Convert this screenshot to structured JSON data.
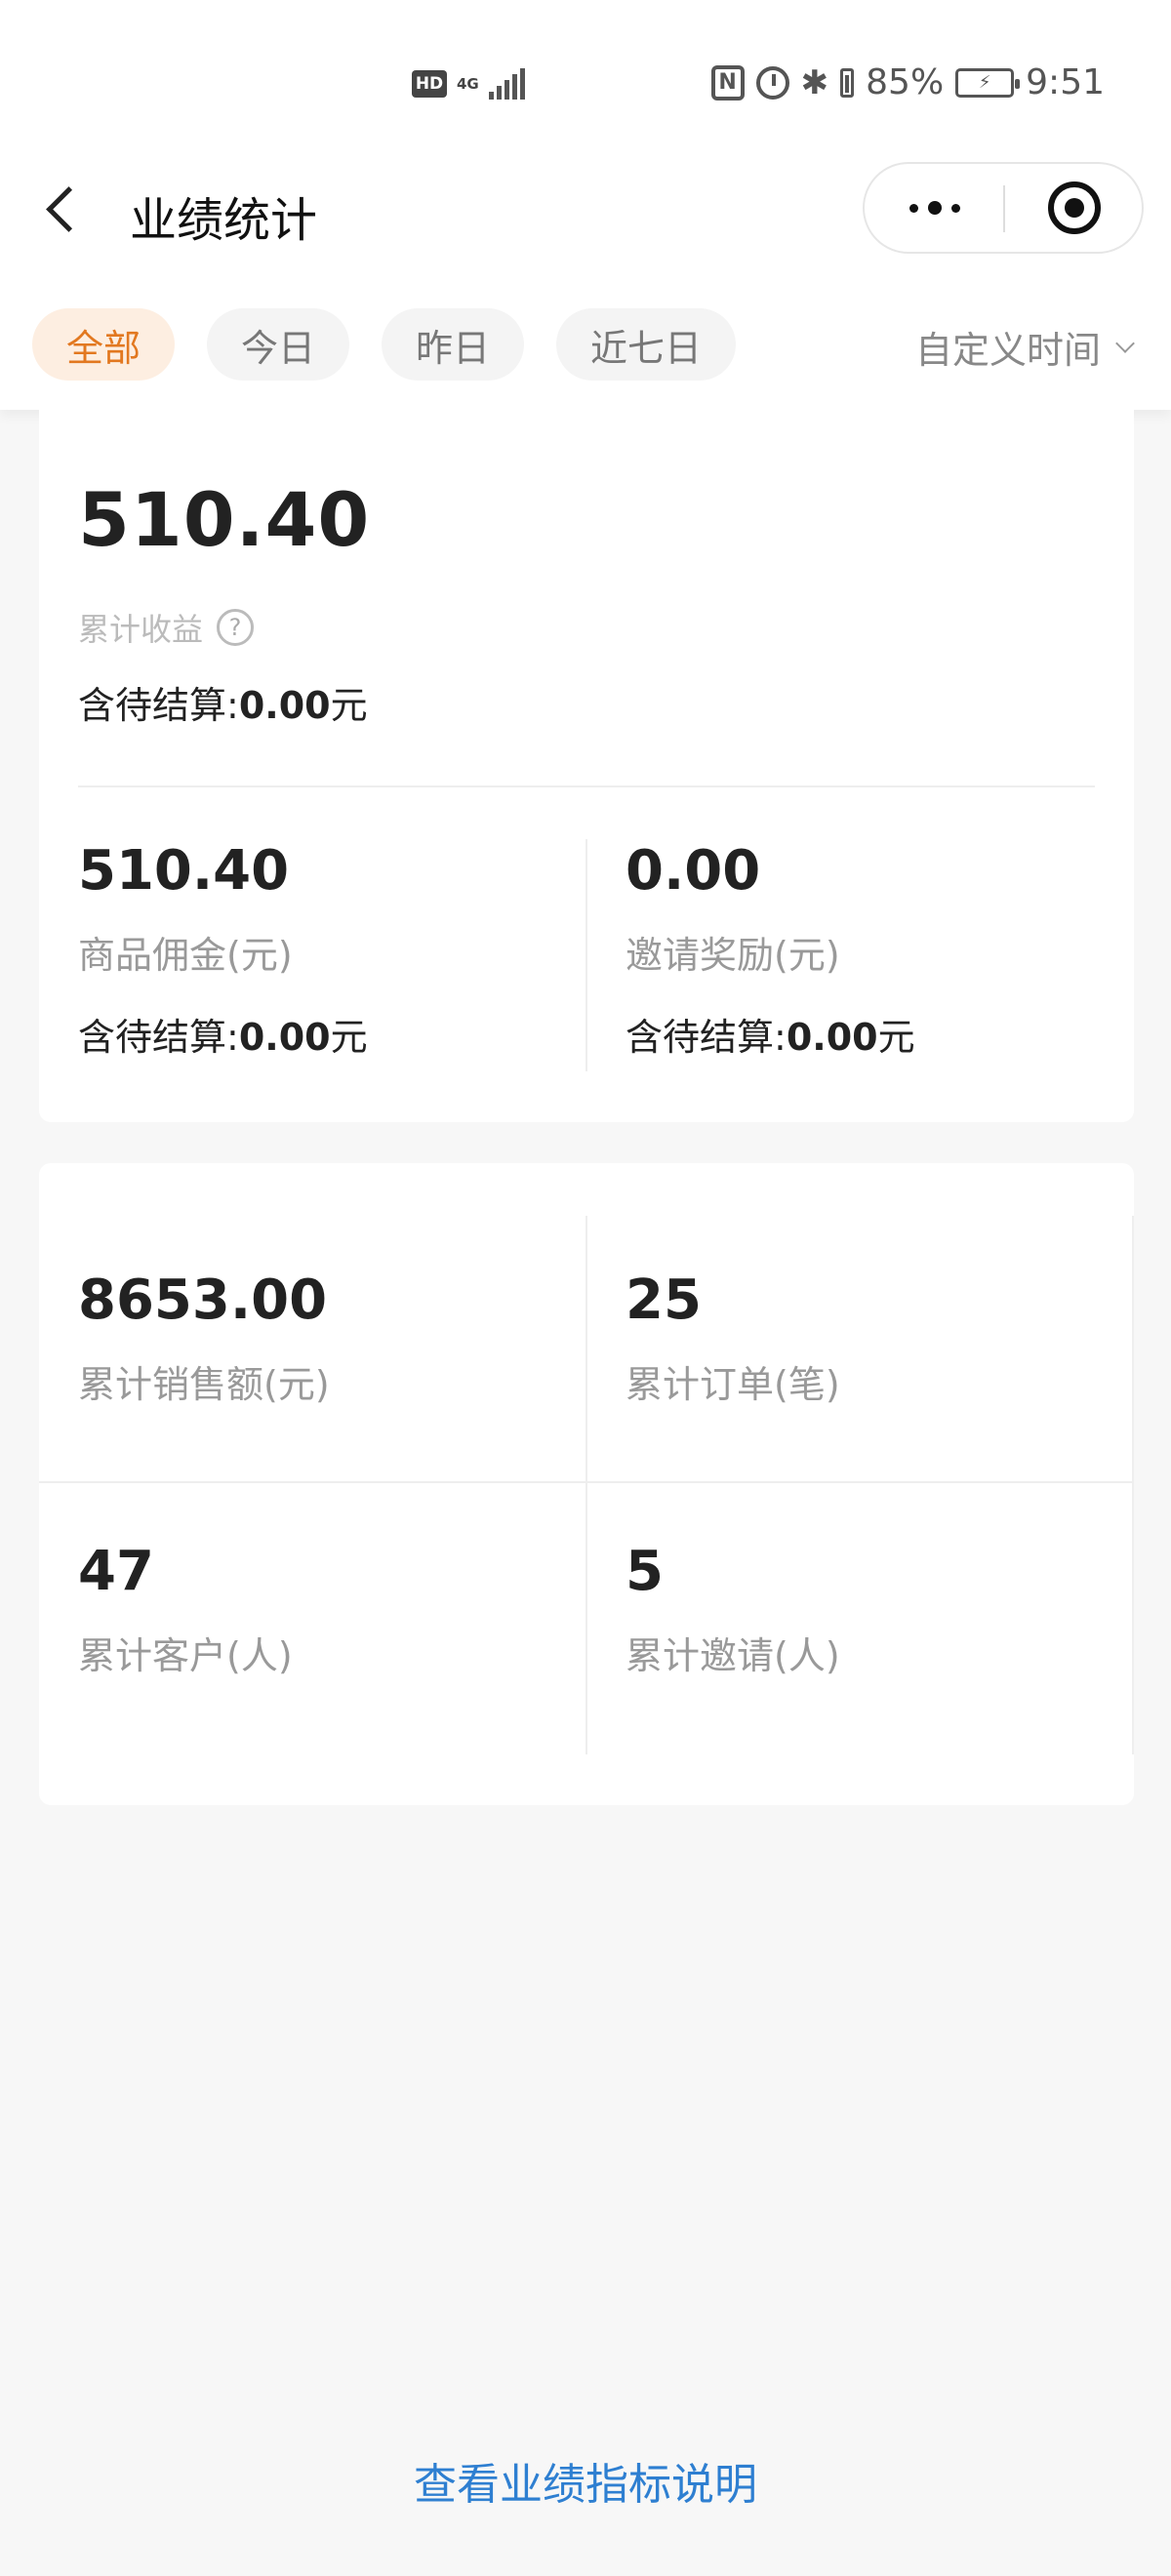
{
  "status_bar": {
    "hd": "HD",
    "network": "4G",
    "battery_percent": "85%",
    "time": "9:51",
    "icons": [
      "hd-icon",
      "signal-icon",
      "nfc-icon",
      "alarm-icon",
      "bluetooth-icon",
      "battery-icon",
      "charging-icon"
    ]
  },
  "nav": {
    "title": "业绩统计"
  },
  "filters": {
    "tabs": [
      {
        "label": "全部",
        "active": true
      },
      {
        "label": "今日",
        "active": false
      },
      {
        "label": "昨日",
        "active": false
      },
      {
        "label": "近七日",
        "active": false
      }
    ],
    "custom_time": "自定义时间"
  },
  "earnings": {
    "total": "510.40",
    "total_label": "累计收益",
    "pending_prefix": "含待结算:",
    "pending_value": "0.00",
    "pending_unit": "元",
    "commission": {
      "value": "510.40",
      "label": "商品佣金(元)",
      "pending_prefix": "含待结算:",
      "pending_value": "0.00",
      "pending_unit": "元"
    },
    "invite_reward": {
      "value": "0.00",
      "label": "邀请奖励(元)",
      "pending_prefix": "含待结算:",
      "pending_value": "0.00",
      "pending_unit": "元"
    }
  },
  "stats": [
    {
      "value": "8653.00",
      "label": "累计销售额(元)"
    },
    {
      "value": "25",
      "label": "累计订单(笔)"
    },
    {
      "value": "47",
      "label": "累计客户(人)"
    },
    {
      "value": "5",
      "label": "累计邀请(人)"
    }
  ],
  "footer": {
    "link": "查看业绩指标说明"
  },
  "colors": {
    "accent": "#e27820",
    "accent_bg": "#fdeee1",
    "link": "#2e7fd1",
    "page_bg": "#f7f7f7"
  }
}
